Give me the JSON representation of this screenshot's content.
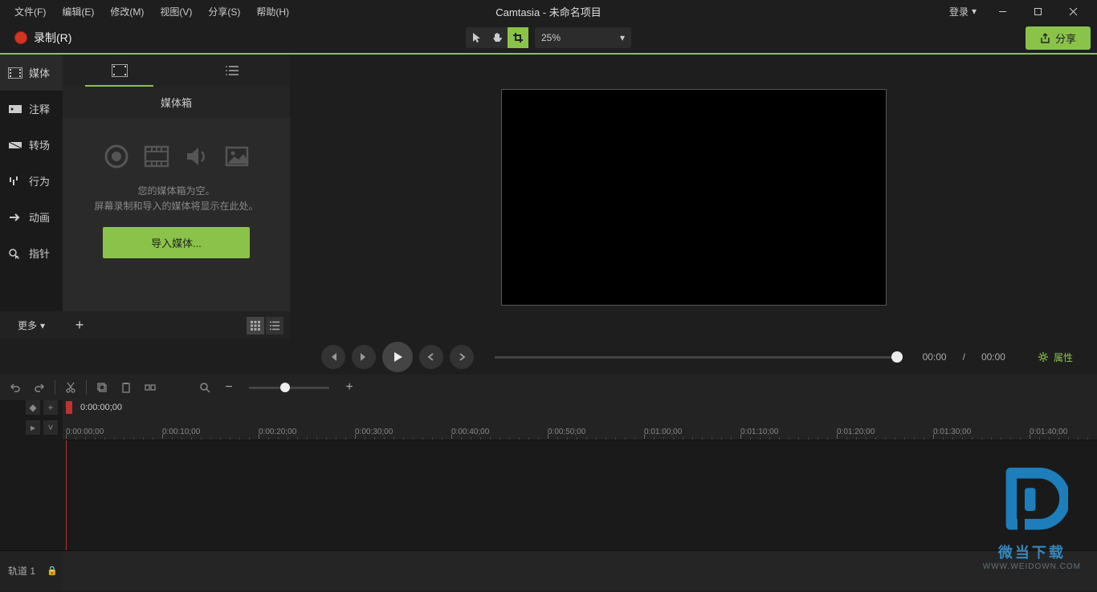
{
  "menu": {
    "file": "文件(F)",
    "edit": "编辑(E)",
    "modify": "修改(M)",
    "view": "视图(V)",
    "share": "分享(S)",
    "help": "帮助(H)"
  },
  "app_title": "Camtasia - 未命名项目",
  "login": "登录",
  "record": "录制(R)",
  "zoom_level": "25%",
  "share_btn": "分享",
  "sidenav": {
    "media": "媒体",
    "annotation": "注释",
    "transition": "转场",
    "behavior": "行为",
    "animation": "动画",
    "cursor": "指针",
    "more": "更多"
  },
  "media_panel": {
    "title": "媒体箱",
    "empty_line1": "您的媒体箱为空。",
    "empty_line2": "屏幕录制和导入的媒体将显示在此处。",
    "import": "导入媒体..."
  },
  "playback": {
    "current": "00:00",
    "sep": "/",
    "total": "00:00",
    "properties": "属性"
  },
  "timeline": {
    "current": "0:00:00;00",
    "ticks": [
      "0:00:00;00",
      "0:00:10;00",
      "0:00:20;00",
      "0:00:30;00",
      "0:00:40;00",
      "0:00:50;00",
      "0:01:00;00",
      "0:01:10;00",
      "0:01:20;00",
      "0:01:30;00",
      "0:01:40;00"
    ],
    "track1": "轨道 1"
  },
  "watermark": {
    "text": "微当下载",
    "url": "WWW.WEIDOWN.COM"
  }
}
